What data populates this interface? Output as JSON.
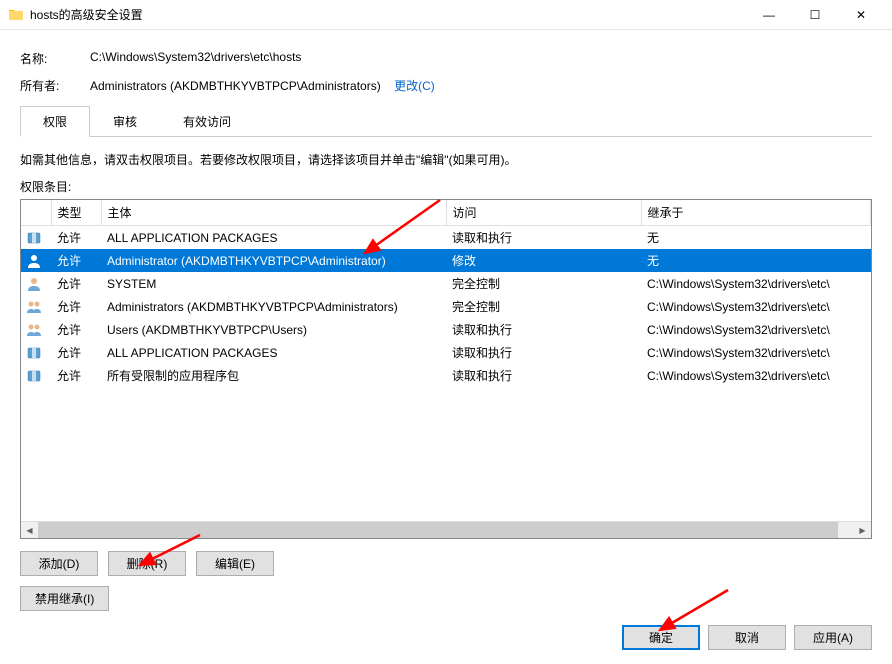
{
  "window": {
    "title": "hosts的高级安全设置",
    "min": "—",
    "max": "☐",
    "close": "✕"
  },
  "fields": {
    "name_label": "名称:",
    "name_value": "C:\\Windows\\System32\\drivers\\etc\\hosts",
    "owner_label": "所有者:",
    "owner_value": "Administrators (AKDMBTHKYVBTPCP\\Administrators)",
    "change_link": "更改(C)"
  },
  "tabs": {
    "permissions": "权限",
    "audit": "审核",
    "effective": "有效访问"
  },
  "instruction": "如需其他信息，请双击权限项目。若要修改权限项目，请选择该项目并单击\"编辑\"(如果可用)。",
  "section_label": "权限条目:",
  "columns": {
    "type": "类型",
    "principal": "主体",
    "access": "访问",
    "inherited": "继承于"
  },
  "rows": [
    {
      "icon": "pkg",
      "type": "允许",
      "principal": "ALL APPLICATION PACKAGES",
      "access": "读取和执行",
      "inherited": "无",
      "selected": false
    },
    {
      "icon": "user",
      "type": "允许",
      "principal": "Administrator (AKDMBTHKYVBTPCP\\Administrator)",
      "access": "修改",
      "inherited": "无",
      "selected": true
    },
    {
      "icon": "user",
      "type": "允许",
      "principal": "SYSTEM",
      "access": "完全控制",
      "inherited": "C:\\Windows\\System32\\drivers\\etc\\",
      "selected": false
    },
    {
      "icon": "group",
      "type": "允许",
      "principal": "Administrators (AKDMBTHKYVBTPCP\\Administrators)",
      "access": "完全控制",
      "inherited": "C:\\Windows\\System32\\drivers\\etc\\",
      "selected": false
    },
    {
      "icon": "group",
      "type": "允许",
      "principal": "Users (AKDMBTHKYVBTPCP\\Users)",
      "access": "读取和执行",
      "inherited": "C:\\Windows\\System32\\drivers\\etc\\",
      "selected": false
    },
    {
      "icon": "pkg",
      "type": "允许",
      "principal": "ALL APPLICATION PACKAGES",
      "access": "读取和执行",
      "inherited": "C:\\Windows\\System32\\drivers\\etc\\",
      "selected": false
    },
    {
      "icon": "pkg",
      "type": "允许",
      "principal": "所有受限制的应用程序包",
      "access": "读取和执行",
      "inherited": "C:\\Windows\\System32\\drivers\\etc\\",
      "selected": false
    }
  ],
  "buttons": {
    "add": "添加(D)",
    "remove": "删除(R)",
    "edit": "编辑(E)",
    "disable_inherit": "禁用继承(I)",
    "ok": "确定",
    "cancel": "取消",
    "apply": "应用(A)"
  }
}
